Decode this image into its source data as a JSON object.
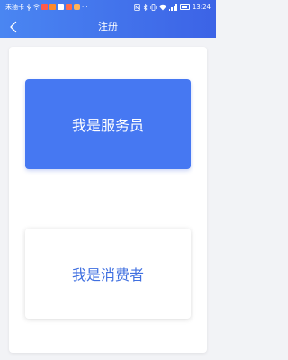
{
  "status_bar": {
    "carrier": "未插卡",
    "time": "13:24",
    "more": "···"
  },
  "header": {
    "title": "注册"
  },
  "roles": {
    "waiter_label": "我是服务员",
    "consumer_label": "我是消费者"
  },
  "colors": {
    "header_gradient_start": "#4a86f2",
    "header_gradient_end": "#3c63e6",
    "primary": "#4678f2",
    "consumer_text": "#3f6fe0",
    "page_bg": "#f2f3f6"
  },
  "icons": {
    "back": "chevron-left-icon"
  }
}
